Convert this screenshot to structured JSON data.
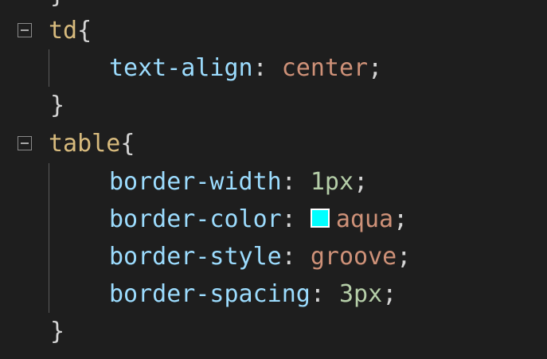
{
  "editor": {
    "top_partial": "}",
    "rules": [
      {
        "selector": "td",
        "open": "{",
        "close": "}",
        "declarations": [
          {
            "property": "text-align",
            "colon": ": ",
            "value": "center",
            "value_type": "keyword",
            "semicolon": ";"
          }
        ]
      },
      {
        "selector": "table",
        "open": "{",
        "close": "}",
        "declarations": [
          {
            "property": "border-width",
            "colon": ": ",
            "value": "1px",
            "value_type": "number",
            "semicolon": ";"
          },
          {
            "property": "border-color",
            "colon": ": ",
            "value": "aqua",
            "value_type": "color",
            "swatch_color": "#00ffff",
            "semicolon": ";"
          },
          {
            "property": "border-style",
            "colon": ": ",
            "value": "groove",
            "value_type": "keyword",
            "semicolon": ";"
          },
          {
            "property": "border-spacing",
            "colon": ": ",
            "value": "3px",
            "value_type": "number",
            "semicolon": ";"
          }
        ]
      }
    ]
  },
  "theme": {
    "background": "#1e1e1e",
    "selector_color": "#d7ba7d",
    "property_color": "#9cdcfe",
    "keyword_color": "#ce9178",
    "number_color": "#b5cea8",
    "punctuation_color": "#d4d4d4"
  },
  "icons": {
    "fold": "collapse-square-icon",
    "color_swatch": "color-swatch-icon"
  }
}
